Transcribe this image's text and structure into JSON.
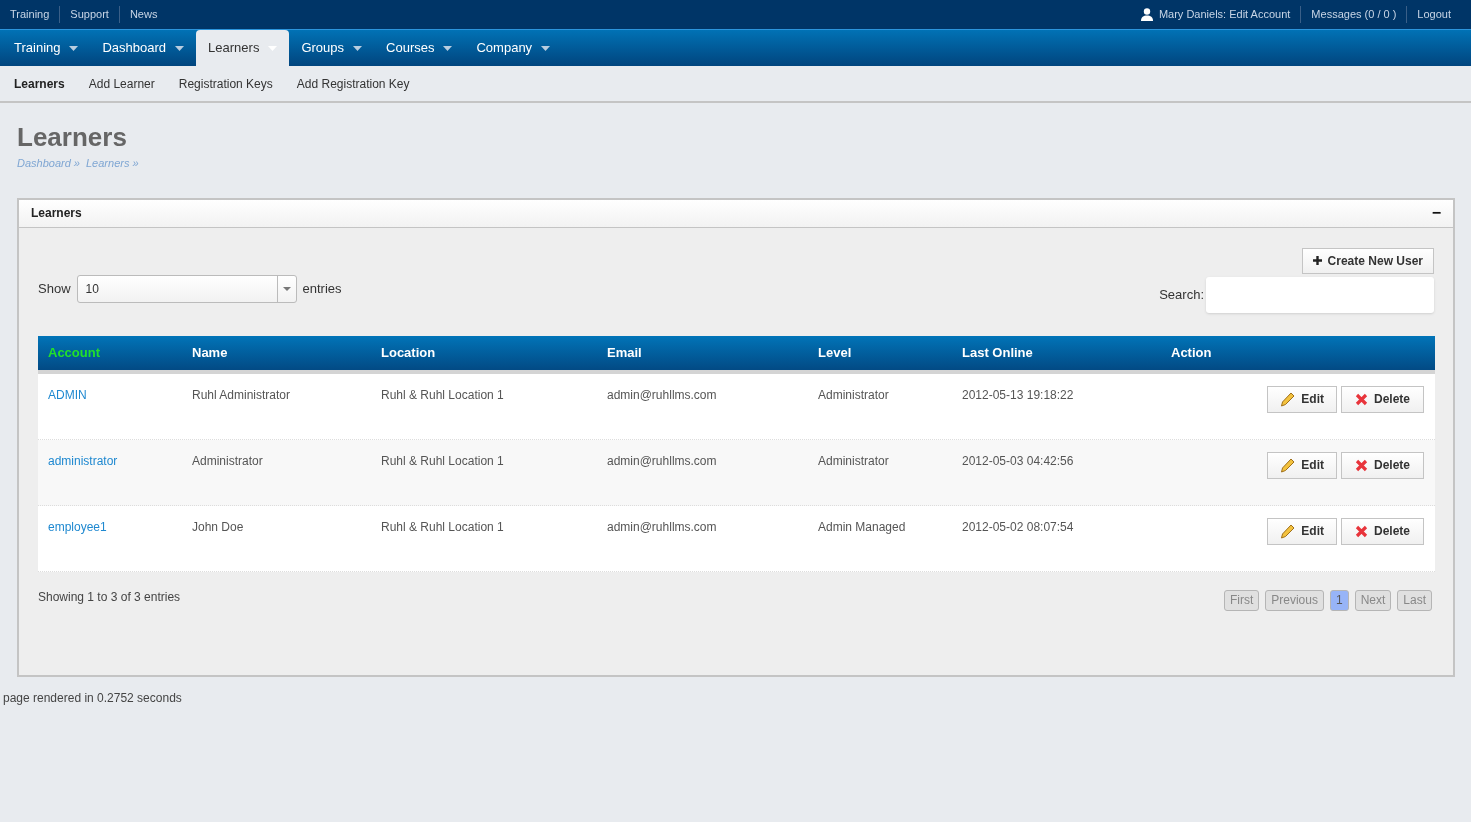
{
  "top_links": [
    "Training",
    "Support",
    "News"
  ],
  "user_links": [
    {
      "label": "Mary Daniels: Edit Account",
      "kind": "user"
    },
    {
      "label": "Messages (0 / 0 )",
      "kind": "plain"
    },
    {
      "label": "Logout",
      "kind": "plain"
    }
  ],
  "nav": [
    {
      "label": "Training",
      "selected": false
    },
    {
      "label": "Dashboard",
      "selected": false
    },
    {
      "label": "Learners",
      "selected": true
    },
    {
      "label": "Groups",
      "selected": false
    },
    {
      "label": "Courses",
      "selected": false
    },
    {
      "label": "Company",
      "selected": false
    }
  ],
  "subnav": [
    {
      "label": "Learners",
      "selected": true
    },
    {
      "label": "Add Learner",
      "selected": false
    },
    {
      "label": "Registration Keys",
      "selected": false
    },
    {
      "label": "Add Registration Key",
      "selected": false
    }
  ],
  "page_title": "Learners",
  "breadcrumbs": [
    "Dashboard »",
    "Learners »"
  ],
  "panel": {
    "title": "Learners",
    "collapse": "−",
    "create_button": "Create New User",
    "show_label": "Show",
    "show_value": "10",
    "entries_label": "entries",
    "search_label": "Search:",
    "table": {
      "columns": [
        {
          "label": "Account",
          "selected": true
        },
        {
          "label": "Name",
          "selected": false
        },
        {
          "label": "Location",
          "selected": false
        },
        {
          "label": "Email",
          "selected": false
        },
        {
          "label": "Level",
          "selected": false
        },
        {
          "label": "Last Online",
          "selected": false
        },
        {
          "label": "Action",
          "selected": false
        }
      ],
      "rows": [
        {
          "account": "ADMIN",
          "name": "Ruhl Administrator",
          "location": "Ruhl & Ruhl Location 1",
          "email": "admin@ruhllms.com",
          "level": "Administrator",
          "last_online": "2012-05-13 19:18:22",
          "actions": [
            "Edit",
            "Delete"
          ]
        },
        {
          "account": "administrator",
          "name": "Administrator",
          "location": "Ruhl & Ruhl Location 1",
          "email": "admin@ruhllms.com",
          "level": "Administrator",
          "last_online": "2012-05-03 04:42:56",
          "actions": [
            "Edit",
            "Delete"
          ]
        },
        {
          "account": "employee1",
          "name": "John Doe",
          "location": "Ruhl & Ruhl Location 1",
          "email": "admin@ruhllms.com",
          "level": "Admin Managed",
          "last_online": "2012-05-02 08:07:54",
          "actions": [
            "Edit",
            "Delete"
          ]
        }
      ]
    },
    "info": "Showing 1 to 3 of 3 entries",
    "pagination": [
      {
        "label": "First",
        "selected": false
      },
      {
        "label": "Previous",
        "selected": false
      },
      {
        "label": "1",
        "selected": true
      },
      {
        "label": "Next",
        "selected": false
      },
      {
        "label": "Last",
        "selected": false
      }
    ]
  },
  "footer": "page rendered in 0.2752 seconds"
}
